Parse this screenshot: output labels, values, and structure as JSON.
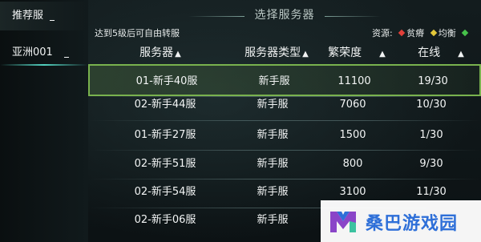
{
  "sidebar": {
    "items": [
      {
        "label": "推荐服"
      },
      {
        "label": "亚洲001"
      }
    ]
  },
  "header": {
    "title": "选择服务器",
    "hint": "达到5级后可自由转服",
    "legend": {
      "label": "资源:",
      "items": [
        {
          "label": "贫瘠",
          "color": "#e2403a"
        },
        {
          "label": "均衡",
          "color": "#e3c83a"
        },
        {
          "label": "",
          "color": "#46c24a"
        }
      ]
    }
  },
  "table": {
    "columns": [
      {
        "label": "服务器",
        "sort_icon": "triangle-up-icon"
      },
      {
        "label": "服务器类型",
        "sort_icon": "triangle-up-icon"
      },
      {
        "label": "繁荣度",
        "sort_icon": "triangle-up-icon"
      },
      {
        "label": "在线",
        "sort_icon": "triangle-up-icon"
      }
    ],
    "rows": [
      {
        "server": "01-新手40服",
        "type": "新手服",
        "prosperity": "11100",
        "online": "19/30",
        "selected": true
      },
      {
        "server": "02-新手44服",
        "type": "新手服",
        "prosperity": "7060",
        "online": "10/30",
        "selected": false
      },
      {
        "server": "01-新手27服",
        "type": "新手服",
        "prosperity": "1500",
        "online": "1/30",
        "selected": false
      },
      {
        "server": "02-新手51服",
        "type": "新手服",
        "prosperity": "800",
        "online": "9/30",
        "selected": false
      },
      {
        "server": "02-新手54服",
        "type": "新手服",
        "prosperity": "3100",
        "online": "11/30",
        "selected": false
      },
      {
        "server": "02-新手06服",
        "type": "新手服",
        "prosperity": "",
        "online": "",
        "selected": false
      }
    ]
  },
  "watermark": {
    "text": "桑巴游戏园",
    "colors": {
      "blue": "#2e6fd8",
      "purple": "#8a45c8",
      "green": "#3cc2a0"
    }
  }
}
